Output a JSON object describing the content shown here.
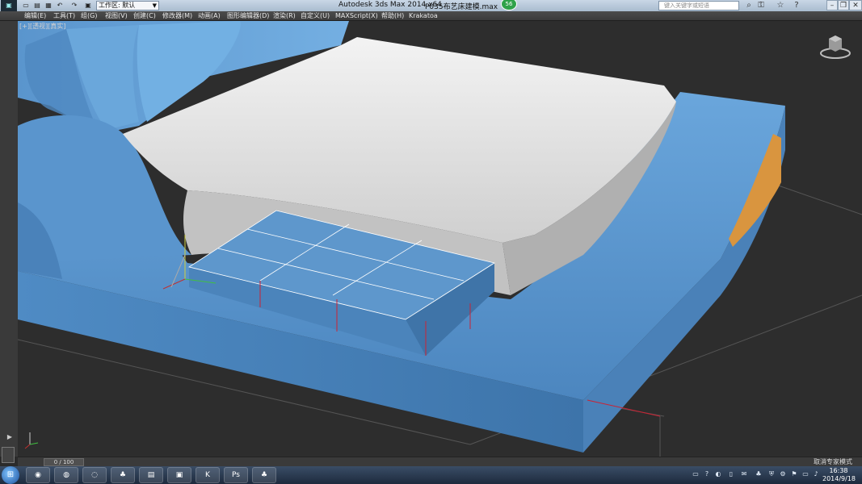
{
  "titlebar": {
    "app_icon": "3ds-max-logo-icon",
    "workspace_value": "工作区: 默认",
    "app_title": "Autodesk 3ds Max  2014 x64",
    "file_title": "P035布艺床建模.max",
    "badge_count": "56",
    "search_placeholder": "键入关键字或短语"
  },
  "menu": {
    "items": [
      "编辑(E)",
      "工具(T)",
      "组(G)",
      "视图(V)",
      "创建(C)",
      "修改器(M)",
      "动画(A)",
      "图形编辑器(D)",
      "渲染(R)",
      "自定义(U)",
      "MAXScript(X)",
      "帮助(H)",
      "Krakatoa"
    ]
  },
  "viewport": {
    "label": "[+][透视][真实]",
    "accent_bed": "#5e98cf",
    "mattress": "#e8e8e8",
    "grid": "#6a6a6a"
  },
  "timeline": {
    "frame": "0 / 100"
  },
  "status": {
    "text": "取消专家模式"
  },
  "taskbar": {
    "clock_time": "16:38",
    "clock_date": "2014/9/18",
    "apps": [
      "browser-icon",
      "chrome-icon",
      "360-icon",
      "qq-icon",
      "explorer-icon",
      "3dsmax-icon",
      "k-icon",
      "photoshop-icon",
      "qq-icon"
    ]
  }
}
